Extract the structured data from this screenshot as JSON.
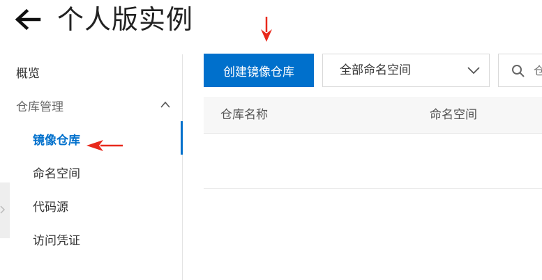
{
  "header": {
    "title": "个人版实例",
    "back_icon": "arrow-left-icon"
  },
  "sidebar": {
    "items": [
      {
        "label": "概览"
      },
      {
        "label": "仓库管理",
        "expanded": true
      },
      {
        "label": "镜像仓库",
        "active": true
      },
      {
        "label": "命名空间"
      },
      {
        "label": "代码源"
      },
      {
        "label": "访问凭证"
      }
    ]
  },
  "toolbar": {
    "create_label": "创建镜像仓库",
    "namespace_select": "全部命名空间",
    "search_placeholder": "仓"
  },
  "table": {
    "columns": [
      "仓库名称",
      "命名空间"
    ]
  },
  "colors": {
    "accent": "#0070cc",
    "annotation_arrow": "#e8291c"
  }
}
